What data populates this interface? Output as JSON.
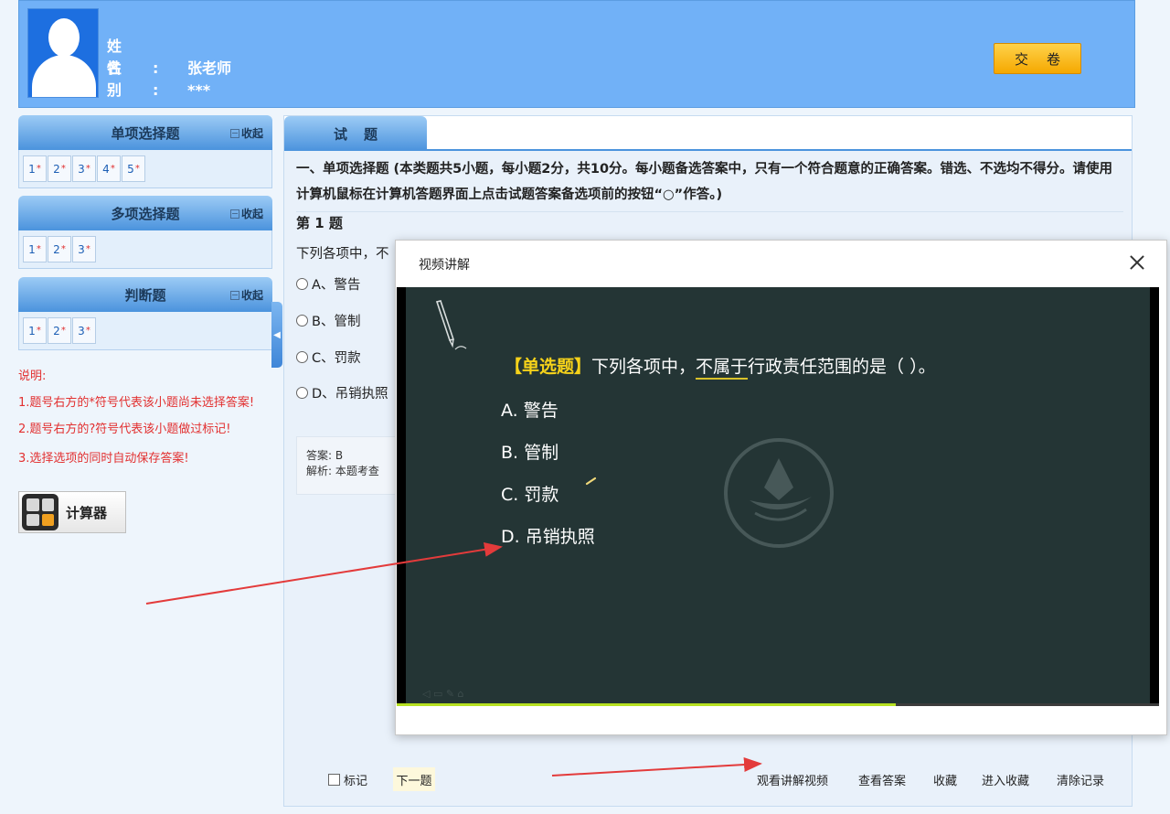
{
  "colors": {
    "header_bg": "#71b1f7",
    "submit_btn": "#f5a800",
    "note_red": "#e23030",
    "panel_head": "#4b93dd",
    "video_bg": "#243535",
    "progress": "#b6e021",
    "arrow": "#e33b3b"
  },
  "header": {
    "name_label": "姓名:",
    "name_value": "张老师",
    "gender_label": "性别:",
    "gender_value": "***",
    "submit_label": "交卷"
  },
  "sidebar": {
    "collapse_label": "收起",
    "sections": [
      {
        "title": "单项选择题",
        "items": [
          "1",
          "2",
          "3",
          "4",
          "5"
        ]
      },
      {
        "title": "多项选择题",
        "items": [
          "1",
          "2",
          "3"
        ]
      },
      {
        "title": "判断题",
        "items": [
          "1",
          "2",
          "3"
        ]
      }
    ],
    "unanswered_marker": "*",
    "notes": {
      "heading": "说明:",
      "line1": "1.题号右方的*符号代表该小题尚未选择答案!",
      "line2": "2.题号右方的?符号代表该小题做过标记!",
      "line3": "3.选择选项的同时自动保存答案!"
    },
    "calculator_label": "计算器"
  },
  "main": {
    "tab_label": "试题",
    "instruction": "一、单项选择题 (本类题共5小题，每小题2分，共10分。每小题备选答案中，只有一个符合题意的正确答案。错选、不选均不得分。请使用计算机鼠标在计算机答题界面上点击试题答案备选项前的按钮“○”作答。)",
    "question_title": "第 1 题",
    "question_stem": "下列各项中，不",
    "options": [
      "A、警告",
      "B、管制",
      "C、罚款",
      "D、吊销执照"
    ],
    "answer_label": "答案: B",
    "analysis_label": "解析: 本题考查"
  },
  "bottom_bar": {
    "mark_label": "标记",
    "next_label": "下一题",
    "links": [
      "观看讲解视频",
      "查看答案",
      "收藏",
      "进入收藏",
      "清除记录"
    ]
  },
  "dialog": {
    "title": "视频讲解",
    "close_icon": "close-icon",
    "video": {
      "tag": "【单选题】",
      "question_before": "下列各项中，",
      "question_underlined": "不属于",
      "question_after": "行政责任范围的是（ ）。",
      "options": [
        "A. 警告",
        "B. 管制",
        "C. 罚款",
        "D. 吊销执照"
      ],
      "progress_fraction": 0.655
    }
  }
}
